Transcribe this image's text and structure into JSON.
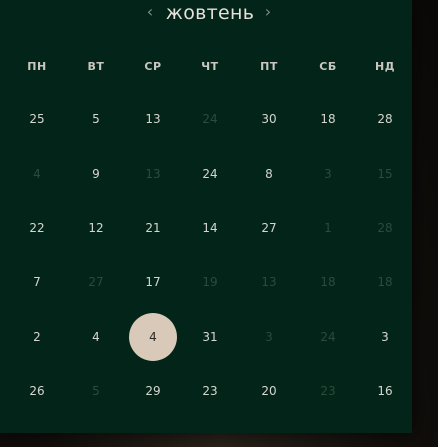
{
  "calendar": {
    "month_label": "жовтень",
    "prev_glyph": "‹",
    "next_glyph": "›",
    "weekdays": [
      "ПН",
      "ВТ",
      "СР",
      "ЧТ",
      "ПТ",
      "СБ",
      "НД"
    ],
    "weeks": [
      [
        {
          "d": "25",
          "dim": false
        },
        {
          "d": "5",
          "dim": false
        },
        {
          "d": "13",
          "dim": false
        },
        {
          "d": "24",
          "dim": true
        },
        {
          "d": "30",
          "dim": false
        },
        {
          "d": "18",
          "dim": false
        },
        {
          "d": "28",
          "dim": false
        }
      ],
      [
        {
          "d": "4",
          "dim": true
        },
        {
          "d": "9",
          "dim": false
        },
        {
          "d": "13",
          "dim": true
        },
        {
          "d": "24",
          "dim": false
        },
        {
          "d": "8",
          "dim": false
        },
        {
          "d": "3",
          "dim": true
        },
        {
          "d": "15",
          "dim": true
        }
      ],
      [
        {
          "d": "22",
          "dim": false
        },
        {
          "d": "12",
          "dim": false
        },
        {
          "d": "21",
          "dim": false
        },
        {
          "d": "14",
          "dim": false
        },
        {
          "d": "27",
          "dim": false
        },
        {
          "d": "1",
          "dim": true
        },
        {
          "d": "28",
          "dim": true
        }
      ],
      [
        {
          "d": "7",
          "dim": false
        },
        {
          "d": "27",
          "dim": true
        },
        {
          "d": "17",
          "dim": false
        },
        {
          "d": "19",
          "dim": true
        },
        {
          "d": "13",
          "dim": true
        },
        {
          "d": "18",
          "dim": true
        },
        {
          "d": "18",
          "dim": true
        }
      ],
      [
        {
          "d": "2",
          "dim": false
        },
        {
          "d": "4",
          "dim": false
        },
        {
          "d": "4",
          "dim": false,
          "selected": true
        },
        {
          "d": "31",
          "dim": false
        },
        {
          "d": "3",
          "dim": true
        },
        {
          "d": "24",
          "dim": true
        },
        {
          "d": "3",
          "dim": false
        }
      ],
      [
        {
          "d": "26",
          "dim": false
        },
        {
          "d": "5",
          "dim": true
        },
        {
          "d": "29",
          "dim": false
        },
        {
          "d": "23",
          "dim": false
        },
        {
          "d": "20",
          "dim": false
        },
        {
          "d": "23",
          "dim": true
        },
        {
          "d": "16",
          "dim": false
        }
      ]
    ]
  },
  "colors": {
    "calendar_bg": "#032419",
    "selected_bg": "#d8c9b8",
    "day_text": "#d6d6cf",
    "dim_text": "#2e4a3d"
  }
}
